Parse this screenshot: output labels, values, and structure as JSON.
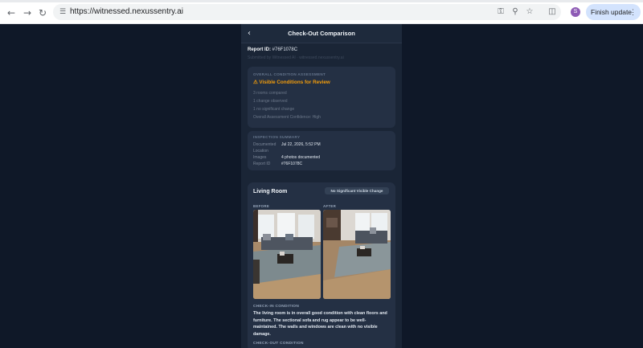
{
  "browser": {
    "url": "https://witnessed.nexussentry.ai",
    "profile_initial": "S",
    "finish_update_label": "Finish update",
    "icons": {
      "back": "arrow-left-icon",
      "forward": "arrow-right-icon",
      "reload": "reload-icon",
      "site_info": "tune-icon",
      "password": "key-icon",
      "zoom": "zoom-icon",
      "bookmark": "star-icon",
      "side_panel": "side-panel-icon",
      "menu": "more-vert-icon"
    }
  },
  "app": {
    "title": "Check-Out Comparison",
    "report_id_label": "Report ID:",
    "report_id": "#76F1078C",
    "submitted_by": "Submitted by Witnessed AI · witnessed.nexussentry.ai"
  },
  "assessment": {
    "label": "OVERALL CONDITION ASSESSMENT",
    "status": "⚠ Visible Conditions for Review",
    "summary_lines": [
      "3 rooms compared",
      "1 change observed",
      "1 no significant change",
      "Overall Assessment Confidence: High"
    ]
  },
  "inspection": {
    "label": "INSPECTION SUMMARY",
    "rows": [
      {
        "key": "Documented",
        "value": "Jul 22, 2026, 5:52 PM"
      },
      {
        "key": "Location",
        "value": ""
      },
      {
        "key": "Images",
        "value": "4 photos documented"
      },
      {
        "key": "Report ID",
        "value": "#76F1078C"
      }
    ]
  },
  "room": {
    "name": "Living Room",
    "badge": "No Significant Visible Change",
    "before_label": "BEFORE",
    "after_label": "AFTER",
    "checkin_label": "CHECK-IN CONDITION",
    "checkin_text": "The living room is in overall good condition with clean floors and furniture. The sectional sofa and rug appear to be well-maintained. The walls and windows are clean with no visible damage.",
    "checkout_label": "CHECK-OUT CONDITION"
  },
  "colors": {
    "page_bg": "#0f1828",
    "panel_bg": "#1a2536",
    "card_bg": "#243044",
    "warning": "#f59e0b",
    "accent_button": "#d3e3fd"
  }
}
